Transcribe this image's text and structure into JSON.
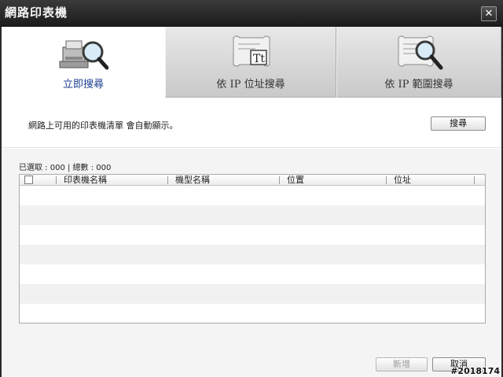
{
  "window": {
    "title": "網路印表機"
  },
  "tabs": [
    {
      "label": "立即搜尋",
      "icon": "printer-search-icon",
      "active": true
    },
    {
      "label": "依 IP 位址搜尋",
      "icon": "ip-scroll-text-icon",
      "active": false
    },
    {
      "label": "依 IP 範圍搜尋",
      "icon": "ip-scroll-search-icon",
      "active": false
    }
  ],
  "search_panel": {
    "message": "網路上可用的印表機清單 會自動顯示。",
    "search_button": "搜尋"
  },
  "list": {
    "counts_label": "已選取 : 000 | 總數 : 000",
    "columns": [
      "印表機名稱",
      "機型名稱",
      "位置",
      "位址"
    ],
    "rows": []
  },
  "footer": {
    "add_button": "新增",
    "cancel_button": "取消"
  },
  "watermark": "#2018174",
  "colors": {
    "active_tab_text": "#1d3d8f",
    "titlebar": "#2a2a2a"
  }
}
